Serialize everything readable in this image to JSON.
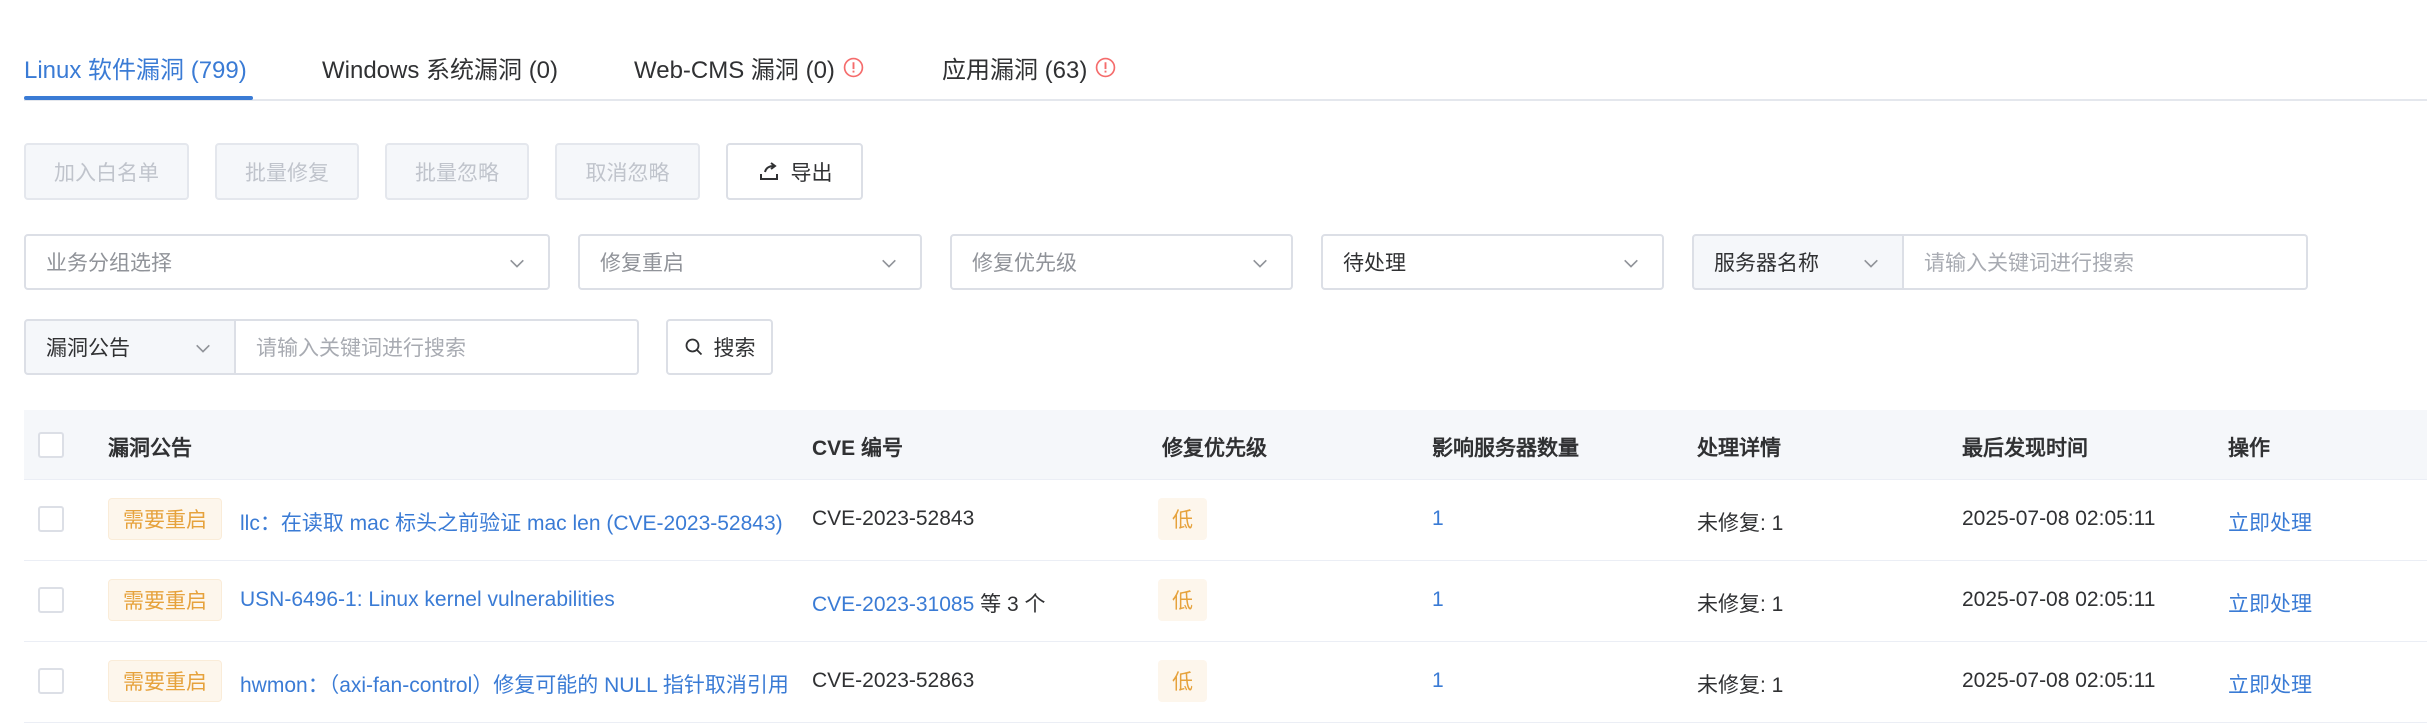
{
  "tabs": [
    {
      "label": "Linux 软件漏洞 (799)",
      "active": true,
      "warning": false
    },
    {
      "label": "Windows 系统漏洞 (0)",
      "active": false,
      "warning": false
    },
    {
      "label": "Web-CMS 漏洞 (0)",
      "active": false,
      "warning": true
    },
    {
      "label": "应用漏洞 (63)",
      "active": false,
      "warning": true
    }
  ],
  "toolbar": {
    "add_whitelist": "加入白名单",
    "batch_fix": "批量修复",
    "batch_ignore": "批量忽略",
    "cancel_ignore": "取消忽略",
    "export": "导出"
  },
  "filters": {
    "business_group_placeholder": "业务分组选择",
    "restart_placeholder": "修复重启",
    "priority_placeholder": "修复优先级",
    "status_value": "待处理",
    "server_field": "服务器名称",
    "server_search_placeholder": "请输入关键词进行搜索",
    "notice_field": "漏洞公告",
    "notice_search_placeholder": "请输入关键词进行搜索",
    "search_button": "搜索"
  },
  "table": {
    "columns": [
      "漏洞公告",
      "CVE 编号",
      "修复优先级",
      "影响服务器数量",
      "处理详情",
      "最后发现时间",
      "操作"
    ],
    "rows": [
      {
        "tag": "需要重启",
        "title": "llc：在读取 mac 标头之前验证 mac len (CVE-2023-52843)",
        "cve": "CVE-2023-52843",
        "cve_link": false,
        "cve_extra": "",
        "priority": "低",
        "servers": "1",
        "detail": "未修复: 1",
        "last_seen": "2025-07-08 02:05:11",
        "action": "立即处理"
      },
      {
        "tag": "需要重启",
        "title": "USN-6496-1: Linux kernel vulnerabilities",
        "cve": "CVE-2023-31085",
        "cve_link": true,
        "cve_extra": "等 3 个",
        "priority": "低",
        "servers": "1",
        "detail": "未修复: 1",
        "last_seen": "2025-07-08 02:05:11",
        "action": "立即处理"
      },
      {
        "tag": "需要重启",
        "title": "hwmon：（axi-fan-control）修复可能的 NULL 指针取消引用",
        "cve": "CVE-2023-52863",
        "cve_link": false,
        "cve_extra": "",
        "priority": "低",
        "servers": "1",
        "detail": "未修复: 1",
        "last_seen": "2025-07-08 02:05:11",
        "action": "立即处理"
      }
    ]
  },
  "colors": {
    "accent": "#3a7bd5",
    "warning": "#f56c6c",
    "tag_text": "#e6a23c",
    "tag_bg": "#fdf6ec"
  }
}
